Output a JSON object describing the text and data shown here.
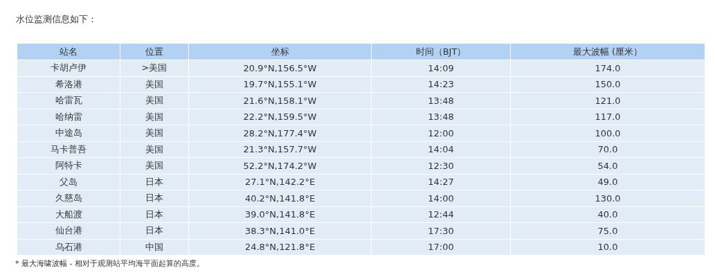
{
  "intro": "水位监测信息如下：",
  "table": {
    "columns": [
      "站名",
      "位置",
      "坐标",
      "时间（BJT）",
      "最大波幅 (厘米）"
    ],
    "rows": [
      [
        "卡胡卢伊",
        ">美国",
        "20.9°N,156.5°W",
        "14:09",
        "174.0"
      ],
      [
        "希洛港",
        "美国",
        "19.7°N,155.1°W",
        "14:23",
        "150.0"
      ],
      [
        "哈雷瓦",
        "美国",
        "21.6°N,158.1°W",
        "13:48",
        "121.0"
      ],
      [
        "哈纳雷",
        "美国",
        "22.2°N,159.5°W",
        "13:48",
        "117.0"
      ],
      [
        "中途岛",
        "美国",
        "28.2°N,177.4°W",
        "12:00",
        "100.0"
      ],
      [
        "马卡普吾",
        "美国",
        "21.3°N,157.7°W",
        "14:04",
        "70.0"
      ],
      [
        "阿特卡",
        "美国",
        "52.2°N,174.2°W",
        "12:30",
        "54.0"
      ],
      [
        "父岛",
        "日本",
        "27.1°N,142.2°E",
        "14:27",
        "49.0"
      ],
      [
        "久慈岛",
        "日本",
        "40.2°N,141.8°E",
        "14:00",
        "130.0"
      ],
      [
        "大船渡",
        "日本",
        "39.0°N,141.8°E",
        "12:44",
        "40.0"
      ],
      [
        "仙台港",
        "日本",
        "38.3°N,141.0°E",
        "17:30",
        "75.0"
      ],
      [
        "乌石港",
        "中国",
        "24.8°N,121.8°E",
        "17:00",
        "10.0"
      ]
    ]
  },
  "footnote": "* 最大海啸波幅 - 相对于观测站平均海平面起算的高度。"
}
